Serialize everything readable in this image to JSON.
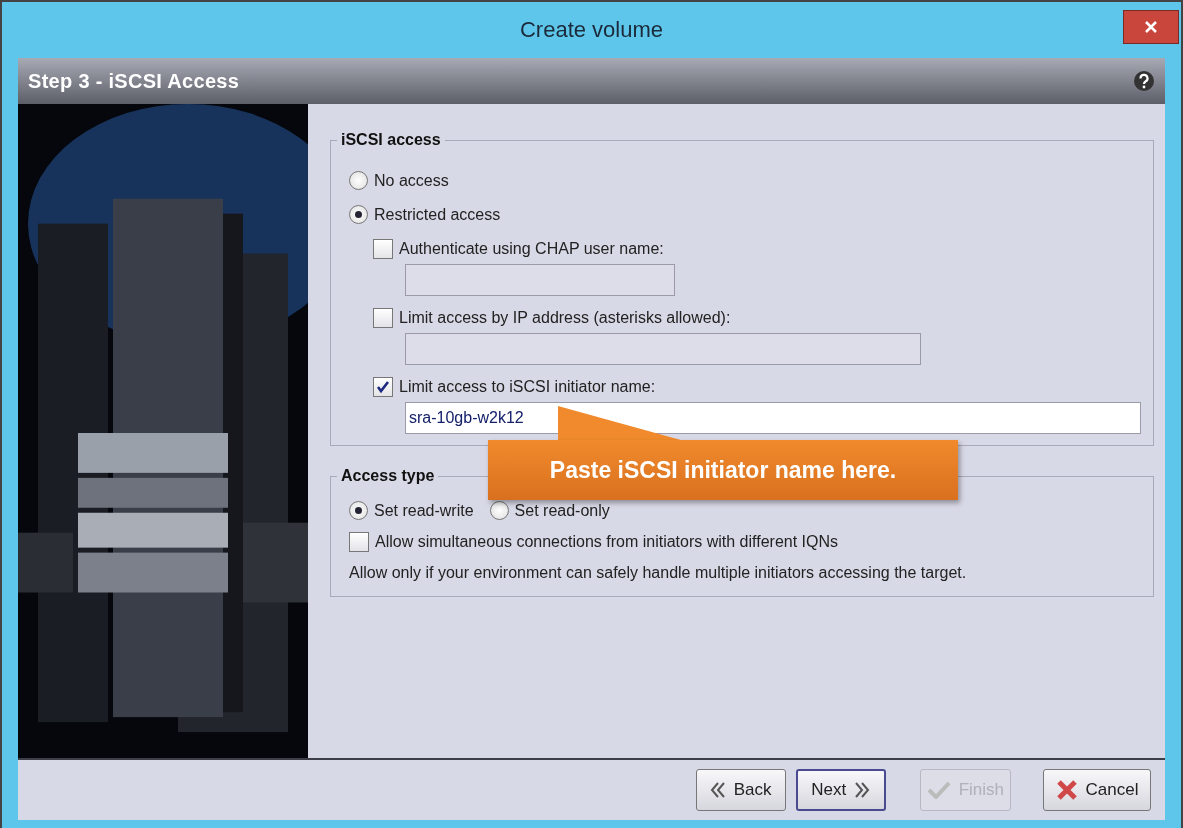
{
  "window": {
    "title": "Create volume"
  },
  "step": {
    "title": "Step 3 - iSCSI Access"
  },
  "iscsi_access": {
    "legend": "iSCSI access",
    "options": [
      {
        "label": "No access",
        "selected": false
      },
      {
        "label": "Restricted access",
        "selected": true
      }
    ],
    "restrictions": [
      {
        "label": "Authenticate using CHAP user name:",
        "checked": false
      },
      {
        "label": "Limit access by IP address (asterisks allowed):",
        "checked": false
      },
      {
        "label": "Limit access to iSCSI initiator name:",
        "checked": true,
        "value": "sra-10gb-w2k12"
      }
    ]
  },
  "access_type": {
    "legend": "Access type",
    "options": [
      {
        "label": "Set read-write",
        "selected": true
      },
      {
        "label": "Set read-only",
        "selected": false
      }
    ],
    "allow": {
      "label": "Allow simultaneous connections from initiators with different IQNs",
      "checked": false
    },
    "note": "Allow only if your environment can safely handle multiple initiators accessing the target."
  },
  "callout": {
    "text": "Paste iSCSI initiator name here."
  },
  "buttons": [
    {
      "label": "Back",
      "kind": "back",
      "disabled": false,
      "focused": false
    },
    {
      "label": "Next",
      "kind": "next",
      "disabled": false,
      "focused": true
    },
    {
      "label": "Finish",
      "kind": "finish",
      "disabled": true,
      "focused": false
    },
    {
      "label": "Cancel",
      "kind": "cancel",
      "disabled": false,
      "focused": false
    }
  ]
}
